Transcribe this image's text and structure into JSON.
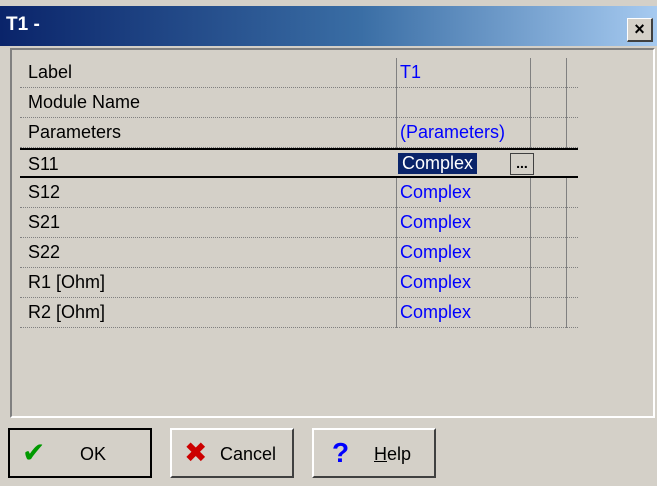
{
  "window": {
    "title": "T1 -",
    "close_label": "×"
  },
  "grid": {
    "rows": [
      {
        "label": "Label",
        "value": "T1"
      },
      {
        "label": "Module Name",
        "value": ""
      },
      {
        "label": "Parameters",
        "value": "(Parameters)"
      },
      {
        "label": "S11",
        "value": "Complex",
        "selected": true
      },
      {
        "label": "S12",
        "value": "Complex"
      },
      {
        "label": "S21",
        "value": "Complex"
      },
      {
        "label": "S22",
        "value": "Complex"
      },
      {
        "label": "R1  [Ohm]",
        "value": "Complex"
      },
      {
        "label": "R2  [Ohm]",
        "value": "Complex"
      }
    ],
    "ellipsis_label": "..."
  },
  "buttons": {
    "ok_label": "OK",
    "cancel_label": "Cancel",
    "help_label": "Help",
    "ok_icon": "check-icon",
    "cancel_icon": "x-icon",
    "help_icon": "question-icon"
  }
}
